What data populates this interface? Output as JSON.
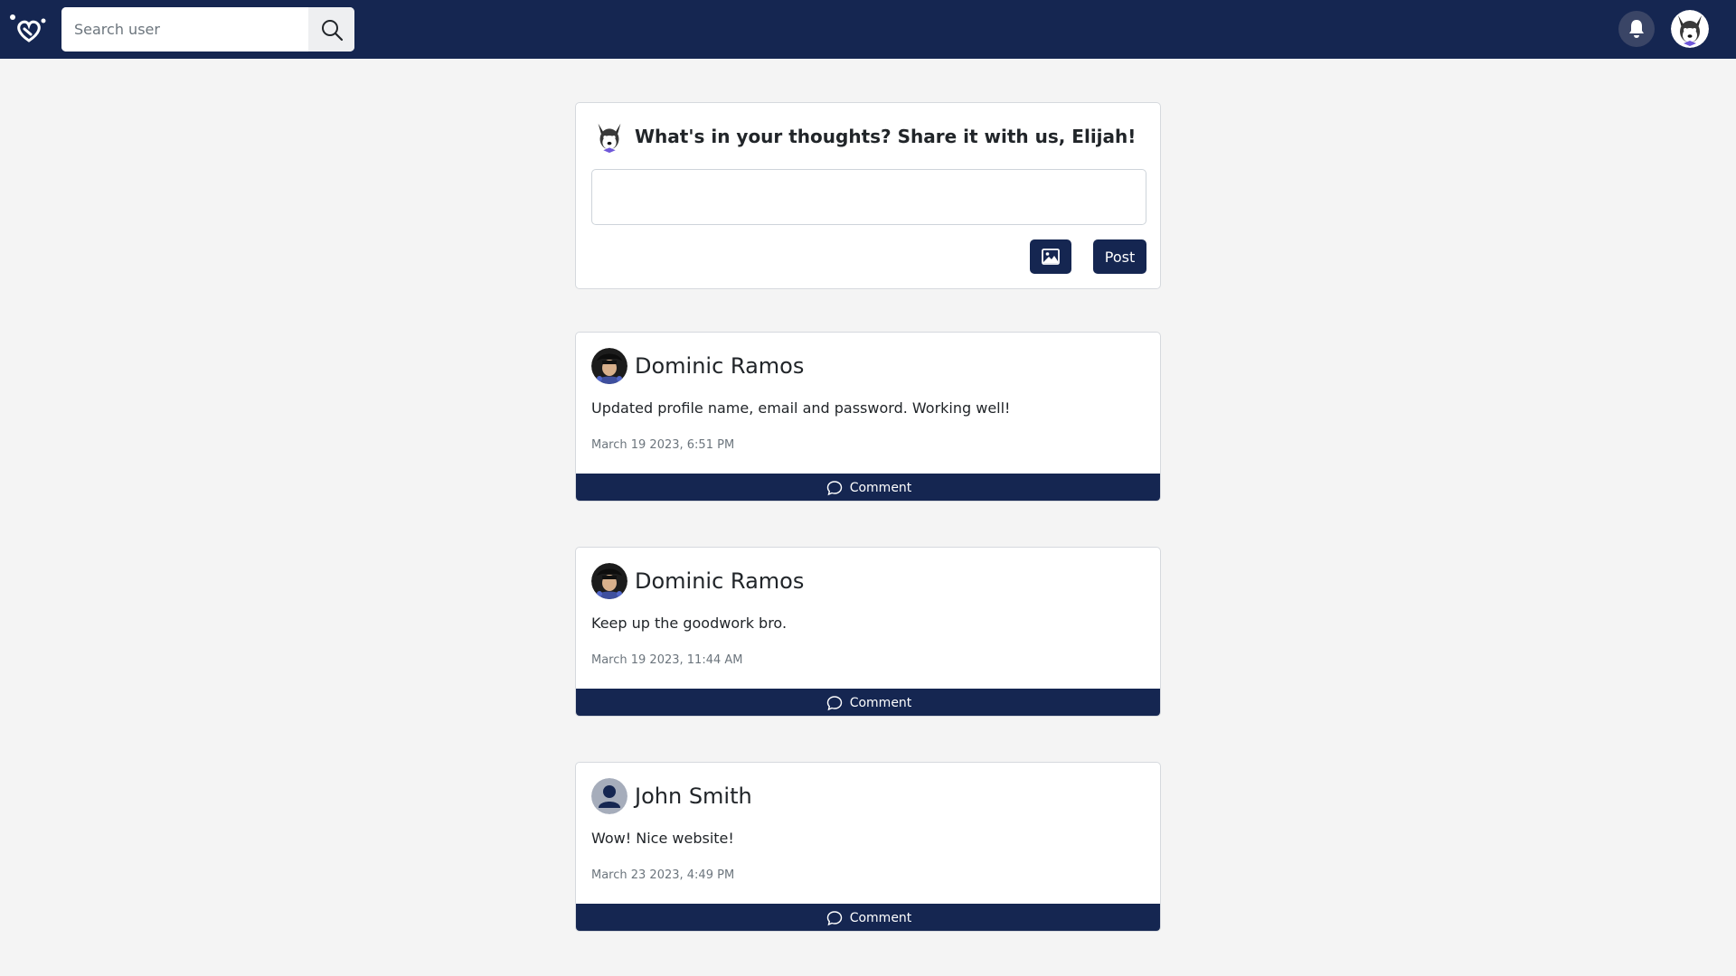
{
  "navbar": {
    "logo_icon": "heart-logo-icon",
    "search": {
      "placeholder": "Search user",
      "value": "",
      "button_icon": "search-icon"
    },
    "notifications_icon": "bell-icon",
    "profile_avatar": "husky-avatar"
  },
  "composer": {
    "prompt": "What's in your thoughts? Share it with us, Elijah!",
    "input_value": "",
    "image_button_icon": "image-icon",
    "post_label": "Post"
  },
  "posts": [
    {
      "author": "Dominic Ramos",
      "avatar": "photo-avatar",
      "text": "Updated profile name, email and password. Working well!",
      "time": "March 19 2023, 6:51 PM",
      "comment_label": "Comment"
    },
    {
      "author": "Dominic Ramos",
      "avatar": "photo-avatar",
      "text": "Keep up the goodwork bro.",
      "time": "March 19 2023, 11:44 AM",
      "comment_label": "Comment"
    },
    {
      "author": "John Smith",
      "avatar": "default-user-avatar",
      "text": "Wow! Nice website!",
      "time": "March 23 2023, 4:49 PM",
      "comment_label": "Comment"
    }
  ],
  "colors": {
    "brand": "#152651",
    "page_bg": "#f4f4f4",
    "card_border": "#d6d9de",
    "muted_text": "#6c757d"
  }
}
